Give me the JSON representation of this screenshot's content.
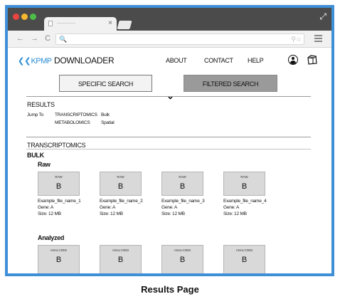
{
  "browser": {
    "tab_close": "×",
    "expand_icon": "⤢",
    "nav_icons": "← → C ⌂",
    "url_search_icon": "🔍",
    "url_right_icons": "⚲☆"
  },
  "header": {
    "logo_mark": "❮❮",
    "logo_org": "KPMP",
    "logo_app": "DOWNLOADER",
    "nav": [
      "ABOUT",
      "CONTACT",
      "HELP"
    ]
  },
  "search_buttons": {
    "specific": "SPECIFIC SEARCH",
    "filtered": "FILTERED SEARCH",
    "chevron": "⌄"
  },
  "results": {
    "title": "RESULTS",
    "jump_to_label": "Jump To",
    "links": [
      [
        "TRANSCRIPTOMICS",
        "Bulk"
      ],
      [
        "METABOLOMICS",
        "Spatial"
      ]
    ]
  },
  "transcriptomics": {
    "title": "TRANSCRIPTOMICS",
    "bulk_label": "BULK",
    "raw": {
      "label": "Raw",
      "cards": [
        {
          "tag": "RAW",
          "letter": "B",
          "name": "Example_file_name_1",
          "gene": "Gene: A",
          "size": "Size: 12 MB"
        },
        {
          "tag": "RAW",
          "letter": "B",
          "name": "Example_file_name_2",
          "gene": "Gene: A",
          "size": "Size: 12 MB"
        },
        {
          "tag": "RAW",
          "letter": "B",
          "name": "Example_file_name_3",
          "gene": "Gene: A",
          "size": "Size: 12 MB"
        },
        {
          "tag": "RAW",
          "letter": "B",
          "name": "Example_file_name_4",
          "gene": "Gene: A",
          "size": "Size: 12 MB"
        }
      ]
    },
    "analyzed": {
      "label": "Analyzed",
      "cards": [
        {
          "tag": "ANALYZED",
          "letter": "B"
        },
        {
          "tag": "ANALYZED",
          "letter": "B"
        },
        {
          "tag": "ANALYZED",
          "letter": "B"
        },
        {
          "tag": "ANALYZED",
          "letter": "B"
        }
      ]
    }
  },
  "caption": "Results Page",
  "colors": {
    "frame": "#3f8fd6",
    "logo": "#2b8ed6",
    "filtered_button": "#9a9a9a",
    "card": "#d9d9d9"
  }
}
